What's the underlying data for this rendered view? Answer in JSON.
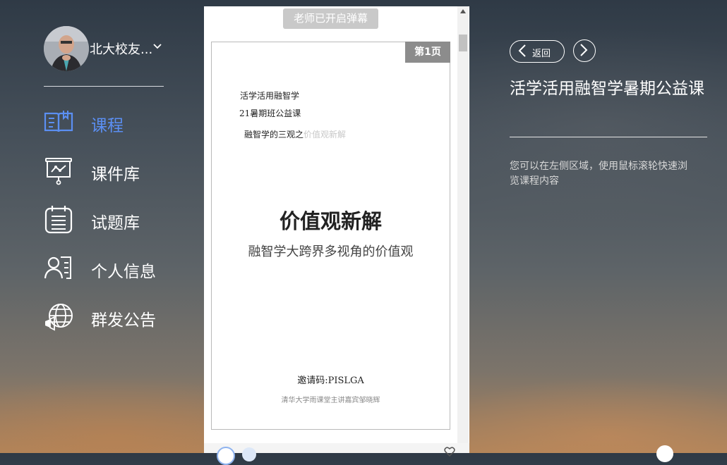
{
  "user": {
    "name": "北大校友..."
  },
  "nav": {
    "items": [
      {
        "label": "课程",
        "icon": "book-icon",
        "active": true
      },
      {
        "label": "课件库",
        "icon": "presentation-icon",
        "active": false
      },
      {
        "label": "试题库",
        "icon": "calendar-list-icon",
        "active": false
      },
      {
        "label": "个人信息",
        "icon": "profile-card-icon",
        "active": false
      },
      {
        "label": "群发公告",
        "icon": "globe-broadcast-icon",
        "active": false
      }
    ]
  },
  "viewer": {
    "danmu_label": "老师已开启弹幕",
    "page_tag": "第1页",
    "slide": {
      "line1": "活学活用融智学",
      "line2": "21暑期班公益课",
      "line3_main": "融智学的三观之",
      "line3_faded": "价值观新解",
      "title": "价值观新解",
      "subtitle": "融智学大跨界多视角的价值观",
      "invite_code": "邀请码:PISLGA",
      "credit": "清华大学雨课堂主讲嘉宾邹晓辉"
    }
  },
  "right_panel": {
    "back_label": "返回",
    "course_title": "活学活用融智学暑期公益课",
    "hint": "您可以在左侧区域，使用鼠标滚轮快速浏览课程内容"
  },
  "colors": {
    "accent": "#5b8ff3"
  }
}
